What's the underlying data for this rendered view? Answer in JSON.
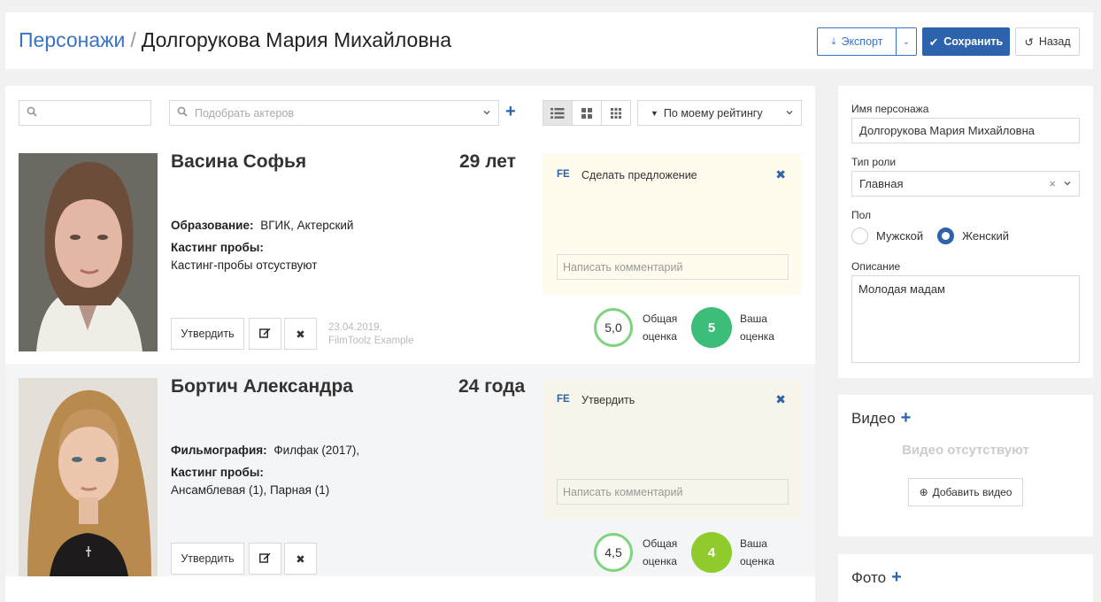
{
  "header": {
    "breadcrumb_root": "Персонажи",
    "breadcrumb_sep": "/",
    "breadcrumb_current": "Долгорукова Мария Михайловна",
    "export_label": "Экспорт",
    "save_label": "Сохранить",
    "back_label": "Назад"
  },
  "toolbar": {
    "search_placeholder": "",
    "actors_placeholder": "Подобрать актеров",
    "sort_label": "По моему рейтингу"
  },
  "actors": [
    {
      "name": "Васина Софья",
      "age": "29 лет",
      "field1_label": "Образование:",
      "field1_value": "ВГИК, Актерский",
      "field2_label": "Кастинг пробы:",
      "field2_value": "Кастинг-пробы отсуствуют",
      "approve_label": "Утвердить",
      "date": "23.04.2019,",
      "author": "FilmToolz Example",
      "comment_tag": "FE",
      "comment_title": "Сделать предложение",
      "comment_placeholder": "Написать комментарий",
      "overall_score": "5,0",
      "overall_label_1": "Общая",
      "overall_label_2": "оценка",
      "your_score": "5",
      "your_label_1": "Ваша",
      "your_label_2": "оценка",
      "your_score_color": "#3cbd78"
    },
    {
      "name": "Бортич Александра",
      "age": "24 года",
      "field1_label": "Фильмография:",
      "field1_value": "Филфак (2017),",
      "field2_label": "Кастинг пробы:",
      "field2_value": "Ансамблевая (1), Парная (1)",
      "approve_label": "Утвердить",
      "comment_tag": "FE",
      "comment_title": "Утвердить",
      "comment_placeholder": "Написать комментарий",
      "overall_score": "4,5",
      "overall_label_1": "Общая",
      "overall_label_2": "оценка",
      "your_score": "4",
      "your_label_1": "Ваша",
      "your_label_2": "оценка",
      "your_score_color": "#8fcb2c"
    }
  ],
  "sidebar": {
    "name_label": "Имя персонажа",
    "name_value": "Долгорукова Мария Михайловна",
    "role_label": "Тип роли",
    "role_value": "Главная",
    "gender_label": "Пол",
    "gender_male": "Мужской",
    "gender_female": "Женский",
    "description_label": "Описание",
    "description_value": "Молодая мадам",
    "video_title": "Видео",
    "video_empty": "Видео отсутствуют",
    "add_video_label": "Добавить видео",
    "photo_title": "Фото"
  },
  "colors": {
    "accent": "#2d62ad",
    "link": "#3a72c5"
  }
}
